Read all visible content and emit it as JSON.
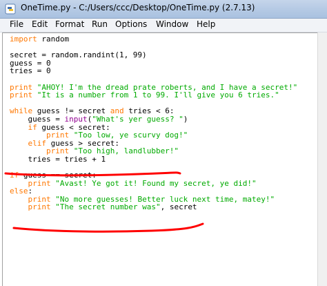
{
  "window": {
    "title": "OneTime.py - C:/Users/ccc/Desktop/OneTime.py (2.7.13)"
  },
  "menu": {
    "items": [
      "File",
      "Edit",
      "Format",
      "Run",
      "Options",
      "Window",
      "Help"
    ]
  },
  "editor": {
    "lines": [
      [
        {
          "t": "import",
          "c": "kw"
        },
        {
          "t": " random",
          "c": ""
        }
      ],
      [],
      [
        {
          "t": "secret = random.randint(1, 99)",
          "c": ""
        }
      ],
      [
        {
          "t": "guess = 0",
          "c": ""
        }
      ],
      [
        {
          "t": "tries = 0",
          "c": ""
        }
      ],
      [],
      [
        {
          "t": "print",
          "c": "kw"
        },
        {
          "t": " ",
          "c": ""
        },
        {
          "t": "\"AHOY! I'm the dread prate roberts, and I have a secret!\"",
          "c": "str"
        }
      ],
      [
        {
          "t": "print",
          "c": "kw"
        },
        {
          "t": " ",
          "c": ""
        },
        {
          "t": "\"It is a number from 1 to 99. I'll give you 6 tries.\"",
          "c": "str"
        }
      ],
      [],
      [
        {
          "t": "while",
          "c": "kw"
        },
        {
          "t": " guess != secret ",
          "c": ""
        },
        {
          "t": "and",
          "c": "kw"
        },
        {
          "t": " tries < 6:",
          "c": ""
        }
      ],
      [
        {
          "t": "    guess = ",
          "c": ""
        },
        {
          "t": "input",
          "c": "bi"
        },
        {
          "t": "(",
          "c": ""
        },
        {
          "t": "\"What's yer guess? \"",
          "c": "str"
        },
        {
          "t": ")",
          "c": ""
        }
      ],
      [
        {
          "t": "    ",
          "c": ""
        },
        {
          "t": "if",
          "c": "kw"
        },
        {
          "t": " guess < secret:",
          "c": ""
        }
      ],
      [
        {
          "t": "        ",
          "c": ""
        },
        {
          "t": "print",
          "c": "kw"
        },
        {
          "t": " ",
          "c": ""
        },
        {
          "t": "\"Too low, ye scurvy dog!\"",
          "c": "str"
        }
      ],
      [
        {
          "t": "    ",
          "c": ""
        },
        {
          "t": "elif",
          "c": "kw"
        },
        {
          "t": " guess > secret:",
          "c": ""
        }
      ],
      [
        {
          "t": "        ",
          "c": ""
        },
        {
          "t": "print",
          "c": "kw"
        },
        {
          "t": " ",
          "c": ""
        },
        {
          "t": "\"Too high, landlubber!\"",
          "c": "str"
        }
      ],
      [
        {
          "t": "    tries = tries + 1",
          "c": ""
        }
      ],
      [],
      [
        {
          "t": "if",
          "c": "kw"
        },
        {
          "t": " guess == secret:",
          "c": ""
        }
      ],
      [
        {
          "t": "    ",
          "c": ""
        },
        {
          "t": "print",
          "c": "kw"
        },
        {
          "t": " ",
          "c": ""
        },
        {
          "t": "\"Avast! Ye got it! Found my secret, ye did!\"",
          "c": "str"
        }
      ],
      [
        {
          "t": "else",
          "c": "kw"
        },
        {
          "t": ":",
          "c": ""
        }
      ],
      [
        {
          "t": "    ",
          "c": ""
        },
        {
          "t": "print",
          "c": "kw"
        },
        {
          "t": " ",
          "c": ""
        },
        {
          "t": "\"No more guesses! Better luck next time, matey!\"",
          "c": "str"
        }
      ],
      [
        {
          "t": "    ",
          "c": ""
        },
        {
          "t": "print",
          "c": "kw"
        },
        {
          "t": " ",
          "c": ""
        },
        {
          "t": "\"The secret number was\"",
          "c": "str"
        },
        {
          "t": ", secret",
          "c": ""
        }
      ]
    ]
  },
  "colors": {
    "keyword": "#ff7700",
    "string": "#00aa00",
    "builtin": "#900090",
    "annotation": "#ff0000"
  },
  "icons": {
    "app": "python-idle-icon"
  }
}
